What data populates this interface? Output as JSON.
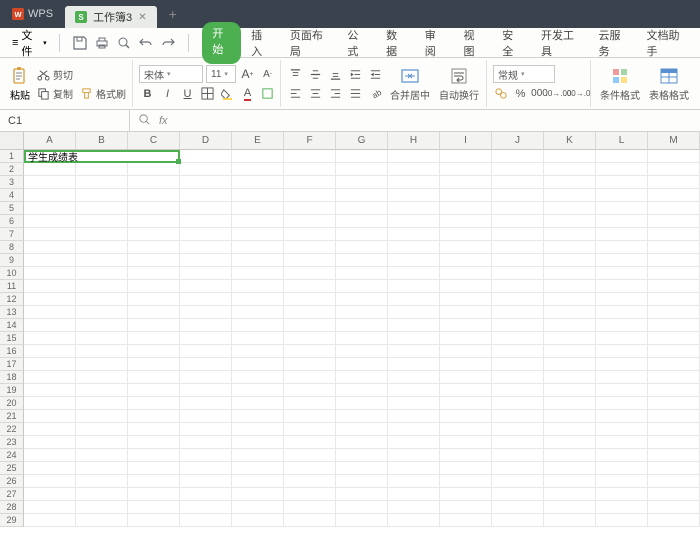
{
  "app": {
    "name": "WPS"
  },
  "tab": {
    "title": "工作簿3"
  },
  "file_menu": "文件",
  "menu_tabs": [
    "开始",
    "插入",
    "页面布局",
    "公式",
    "数据",
    "审阅",
    "视图",
    "安全",
    "开发工具",
    "云服务",
    "文档助手"
  ],
  "active_menu_tab": "开始",
  "clipboard": {
    "paste": "粘贴",
    "cut": "剪切",
    "copy": "复制",
    "format_painter": "格式刷"
  },
  "font": {
    "name": "宋体",
    "size": "11"
  },
  "align": {
    "merge": "合并居中",
    "wrap": "自动换行"
  },
  "number_format": "常规",
  "cond_format": "条件格式",
  "table_format": "表格格式",
  "name_box": "C1",
  "cell_a1": "学生成绩表",
  "columns": [
    "A",
    "B",
    "C",
    "D",
    "E",
    "F",
    "G",
    "H",
    "I",
    "J",
    "K",
    "L",
    "M"
  ],
  "row_count": 29
}
